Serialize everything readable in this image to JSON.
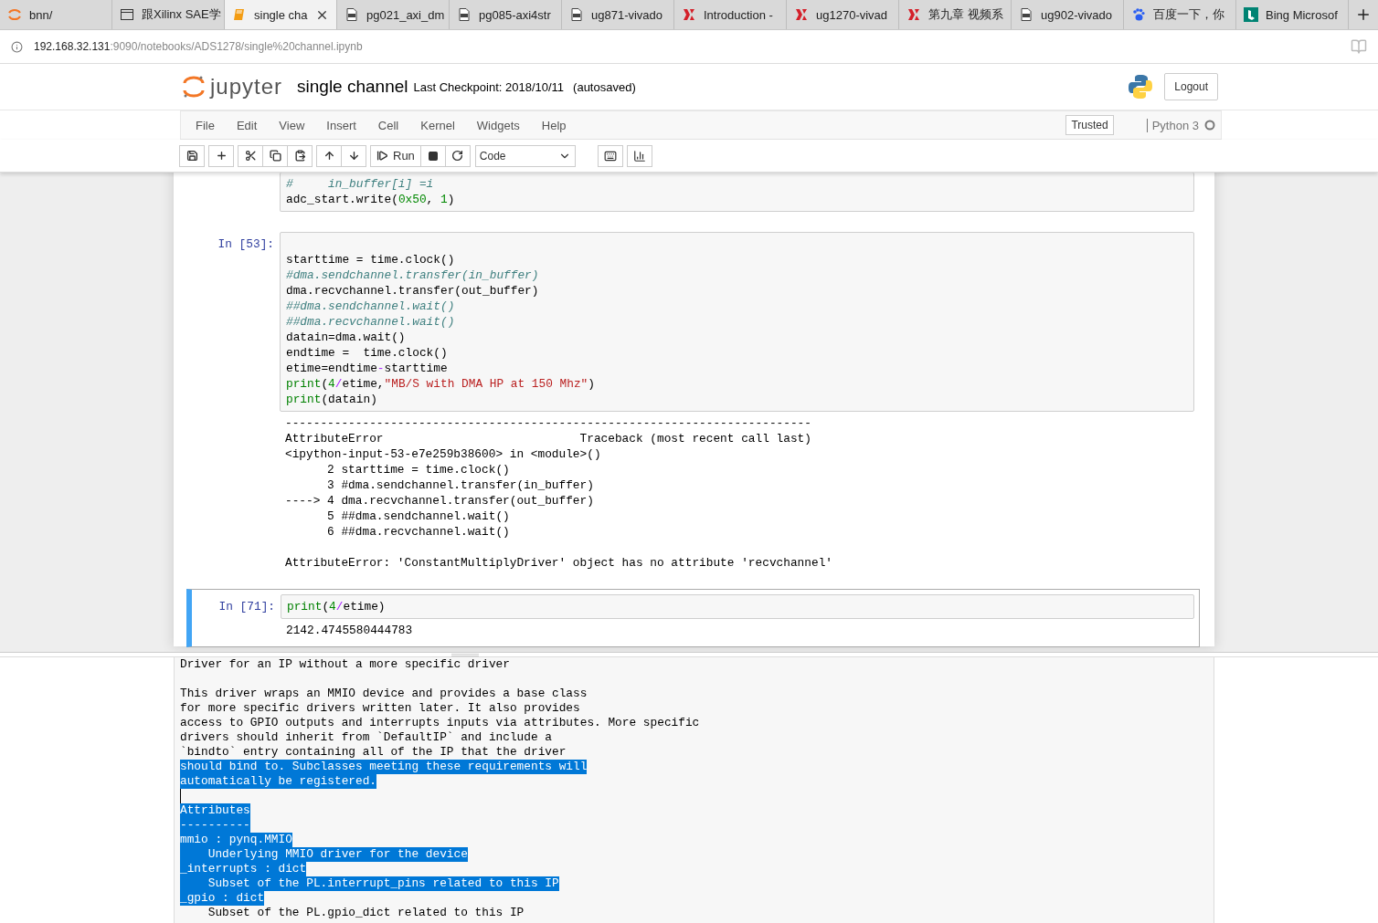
{
  "browser_tabs": [
    {
      "label": "bnn/",
      "kind": "jupyter",
      "selected": false
    },
    {
      "label": "跟Xilinx SAE学",
      "kind": "window",
      "selected": false
    },
    {
      "label": "single cha",
      "kind": "book",
      "selected": true
    },
    {
      "label": "pg021_axi_dm",
      "kind": "pdf",
      "selected": false
    },
    {
      "label": "pg085-axi4str",
      "kind": "pdf",
      "selected": false
    },
    {
      "label": "ug871-vivado",
      "kind": "pdf",
      "selected": false
    },
    {
      "label": "Introduction -",
      "kind": "xilinx",
      "selected": false
    },
    {
      "label": "ug1270-vivad",
      "kind": "xilinx",
      "selected": false
    },
    {
      "label": "第九章 视频系",
      "kind": "xilinx",
      "selected": false
    },
    {
      "label": "ug902-vivado",
      "kind": "pdf",
      "selected": false
    },
    {
      "label": "百度一下，你",
      "kind": "paw",
      "selected": false
    },
    {
      "label": "Bing Microsof",
      "kind": "bing",
      "selected": false
    }
  ],
  "address": {
    "host": "192.168.32.131",
    "path": ":9090/notebooks/ADS1278/single%20channel.ipynb"
  },
  "header": {
    "logo_text": "jupyter",
    "notebook_name": "single channel",
    "checkpoint": "Last Checkpoint: 2018/10/11",
    "autosave": "(autosaved)",
    "logout": "Logout"
  },
  "menu": {
    "items": [
      "File",
      "Edit",
      "View",
      "Insert",
      "Cell",
      "Kernel",
      "Widgets",
      "Help"
    ],
    "trusted": "Trusted",
    "kernel": "Python 3",
    "kernel_busy": false
  },
  "toolbar": {
    "run": "Run",
    "cell_type": "Code"
  },
  "cells": [
    {
      "selected": false,
      "lines": [
        [
          {
            "kind": "comment",
            "text": "#     in_buffer[i] =i"
          }
        ],
        [
          {
            "kind": "plain",
            "text": "adc_start.write("
          },
          {
            "kind": "number",
            "text": "0x50"
          },
          {
            "kind": "plain",
            "text": ", "
          },
          {
            "kind": "number",
            "text": "1"
          },
          {
            "kind": "plain",
            "text": ")"
          }
        ]
      ]
    },
    {
      "prompt": "In [53]:",
      "selected": false,
      "blank_first_line": true,
      "lines": [
        [
          {
            "kind": "plain",
            "text": "starttime = time.clock()"
          }
        ],
        [
          {
            "kind": "comment",
            "text": "#dma.sendchannel.transfer(in_buffer)"
          }
        ],
        [
          {
            "kind": "plain",
            "text": "dma.recvchannel.transfer(out_buffer)"
          }
        ],
        [
          {
            "kind": "comment",
            "text": "##dma.sendchannel.wait()"
          }
        ],
        [
          {
            "kind": "comment",
            "text": "##dma.recvchannel.wait()"
          }
        ],
        [
          {
            "kind": "plain",
            "text": "datain=dma.wait()"
          }
        ],
        [
          {
            "kind": "plain",
            "text": "endtime =  time.clock()"
          }
        ],
        [
          {
            "kind": "plain",
            "text": "etime=endtime"
          },
          {
            "kind": "operator",
            "text": "-"
          },
          {
            "kind": "plain",
            "text": "starttime"
          }
        ],
        [
          {
            "kind": "builtin",
            "text": "print"
          },
          {
            "kind": "plain",
            "text": "("
          },
          {
            "kind": "number",
            "text": "4"
          },
          {
            "kind": "operator",
            "text": "/"
          },
          {
            "kind": "plain",
            "text": "etime,"
          },
          {
            "kind": "string",
            "text": "\"MB/S with DMA HP at 150 Mhz\""
          },
          {
            "kind": "plain",
            "text": ")"
          }
        ],
        [
          {
            "kind": "builtin",
            "text": "print"
          },
          {
            "kind": "plain",
            "text": "(datain)"
          }
        ]
      ],
      "traceback": [
        "---------------------------------------------------------------------------",
        "AttributeError                            Traceback (most recent call last)",
        "<ipython-input-53-e7e259b38600> in <module>()",
        "      2 starttime = time.clock()",
        "      3 #dma.sendchannel.transfer(in_buffer)",
        "----> 4 dma.recvchannel.transfer(out_buffer)",
        "      5 ##dma.sendchannel.wait()",
        "      6 ##dma.recvchannel.wait()"
      ],
      "error": "AttributeError: 'ConstantMultiplyDriver' object has no attribute 'recvchannel'"
    },
    {
      "prompt": "In [71]:",
      "selected": true,
      "lines": [
        [
          {
            "kind": "builtin",
            "text": "print"
          },
          {
            "kind": "plain",
            "text": "("
          },
          {
            "kind": "number",
            "text": "4"
          },
          {
            "kind": "operator",
            "text": "/"
          },
          {
            "kind": "plain",
            "text": "etime)"
          }
        ]
      ],
      "output": [
        "2142.4745580444783"
      ]
    }
  ],
  "pager": [
    {
      "text": "Driver for an IP without a more specific driver",
      "highlighted": false
    },
    {
      "text": "This driver wraps an MMIO device and provides a base class",
      "highlighted": false,
      "gap_before": true
    },
    {
      "text": "for more specific drivers written later. It also provides",
      "highlighted": false
    },
    {
      "text": "access to GPIO outputs and interrupts inputs via attributes. More specific",
      "highlighted": false
    },
    {
      "text": "drivers should inherit from `DefaultIP` and include a",
      "highlighted": false
    },
    {
      "text": "`bindto` entry containing all of the IP that the driver",
      "highlighted": false
    },
    {
      "text": "should bind to. Subclasses meeting these requirements will",
      "highlighted": true
    },
    {
      "text": "automatically be registered.",
      "highlighted": true
    },
    {
      "caret": true
    },
    {
      "text": "Attributes",
      "highlighted": true
    },
    {
      "text": "----------",
      "highlighted": true
    },
    {
      "text": "mmio : pynq.MMIO",
      "highlighted": true
    },
    {
      "text": "    Underlying MMIO driver for the device",
      "highlighted": true
    },
    {
      "text": "_interrupts : dict",
      "highlighted": true
    },
    {
      "text": "    Subset of the PL.interrupt_pins related to this IP",
      "highlighted": true
    },
    {
      "text": "_gpio : dict",
      "highlighted": true
    },
    {
      "text": "    Subset of the PL.gpio_dict related to this IP",
      "highlighted": false
    }
  ]
}
